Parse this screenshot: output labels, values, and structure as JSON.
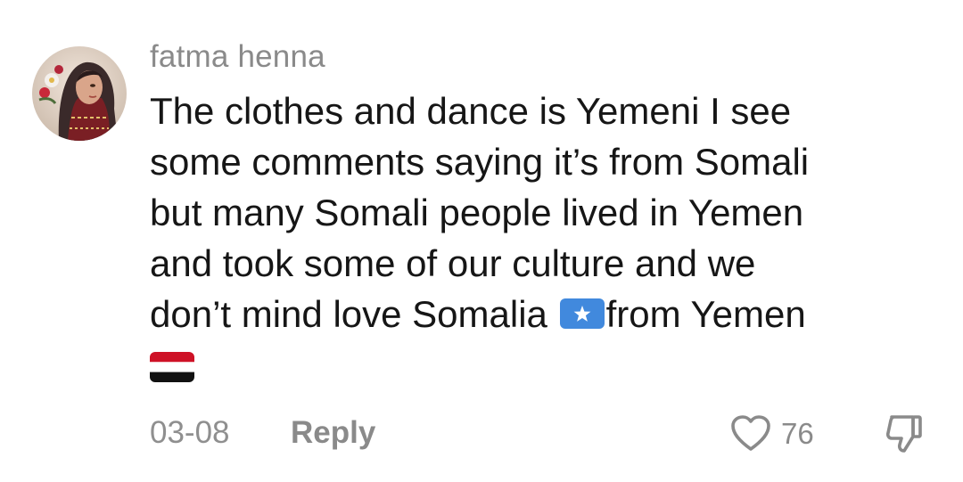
{
  "comment": {
    "username": "fatma henna",
    "text_lines": [
      "The clothes and dance is Yemeni I see",
      "some comments saying it’s from Somali",
      "but many Somali people lived in Yemen",
      "and took some of our culture and we"
    ],
    "last_line_before_flag": "don’t mind love Somalia ",
    "last_line_after_flag": "from Yemen",
    "flags": [
      "somalia-flag",
      "yemen-flag"
    ],
    "date": "03-08",
    "reply_label": "Reply",
    "like_count": "76"
  },
  "icons": {
    "like": "heart-outline-icon",
    "dislike": "thumbs-down-outline-icon"
  },
  "colors": {
    "text": "#161616",
    "muted": "#8a8a8a",
    "somalia_blue": "#4189dd",
    "yemen_red": "#ce1126"
  }
}
